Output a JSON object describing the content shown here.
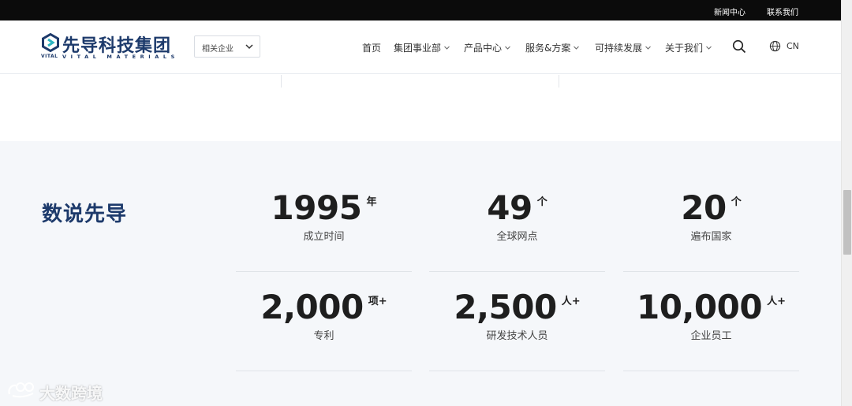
{
  "topbar": {
    "news": "新闻中心",
    "contact": "联系我们"
  },
  "header": {
    "logo": {
      "cn": "先导科技集团",
      "en_short": "VITAL",
      "en": "VITAL MATERIALS"
    },
    "company_select": {
      "label": "相关企业"
    },
    "nav": [
      {
        "label": "首页",
        "has_caret": false
      },
      {
        "label": "集团事业部",
        "has_caret": true
      },
      {
        "label": "产品中心",
        "has_caret": true
      },
      {
        "label": "服务&方案",
        "has_caret": true
      },
      {
        "label": "可持续发展",
        "has_caret": true
      },
      {
        "label": "关于我们",
        "has_caret": true
      }
    ],
    "lang": "CN"
  },
  "stats": {
    "title": "数说先导",
    "items": [
      {
        "value": "1995",
        "unit": "年",
        "label": "成立时间"
      },
      {
        "value": "49",
        "unit": "个",
        "label": "全球网点"
      },
      {
        "value": "20",
        "unit": "个",
        "label": "遍布国家"
      },
      {
        "value": "2,000",
        "unit": "项+",
        "label": "专利"
      },
      {
        "value": "2,500",
        "unit": "人+",
        "label": "研发技术人员"
      },
      {
        "value": "10,000",
        "unit": "人+",
        "label": "企业员工"
      }
    ]
  },
  "watermark": {
    "text": "大数跨境"
  },
  "colors": {
    "brand": "#1d3a6b",
    "topbar": "#0b0b0b",
    "stats_bg": "#f5f7fa"
  }
}
